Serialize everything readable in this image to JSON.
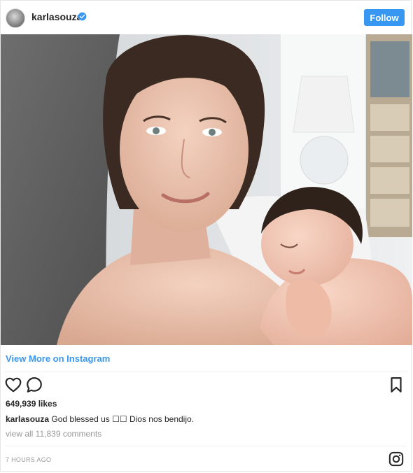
{
  "header": {
    "username": "karlasouza",
    "follow_label": "Follow",
    "avatar_icon": "profile-avatar",
    "verified_icon": "verified-badge-icon"
  },
  "photo": {
    "description_icon": "post-photo"
  },
  "view_more_label": "View More on Instagram",
  "actions": {
    "like_icon": "heart-icon",
    "comment_icon": "comment-icon",
    "save_icon": "bookmark-icon"
  },
  "likes": "649,939 likes",
  "caption": {
    "author": "karlasouza",
    "text": "God blessed us ☐☐ Dios nos bendijo."
  },
  "comments_link": "view all 11,839 comments",
  "timestamp": "7 HOURS AGO",
  "footer_icon": "instagram-logo-icon",
  "colors": {
    "accent": "#3897f0",
    "text": "#262626",
    "muted": "#999999"
  }
}
